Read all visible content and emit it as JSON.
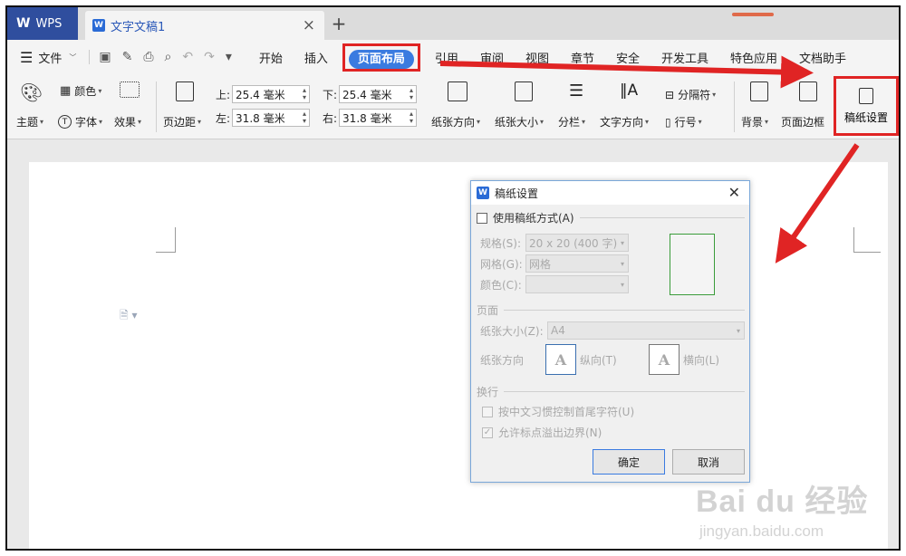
{
  "titlebar": {
    "app_tab": "WPS",
    "doc_tab": "文字文稿1",
    "close_glyph": "×",
    "new_tab_glyph": "+"
  },
  "menubar": {
    "file": "文件",
    "items": [
      "开始",
      "插入",
      "页面布局",
      "引用",
      "审阅",
      "视图",
      "章节",
      "安全",
      "开发工具",
      "特色应用",
      "文档助手"
    ],
    "active_index": 2
  },
  "ribbon": {
    "theme": "主题",
    "color": "颜色",
    "font": "字体",
    "effect": "效果",
    "margins": "页边距",
    "margin_top_label": "上:",
    "margin_top": "25.4 毫米",
    "margin_bottom_label": "下:",
    "margin_bottom": "25.4 毫米",
    "margin_left_label": "左:",
    "margin_left": "31.8 毫米",
    "margin_right_label": "右:",
    "margin_right": "31.8 毫米",
    "orientation": "纸张方向",
    "paper_size": "纸张大小",
    "columns": "分栏",
    "text_direction": "文字方向",
    "separator": "分隔符",
    "line_number": "行号",
    "background": "背景",
    "page_border": "页面边框",
    "grid_paper": "稿纸设置"
  },
  "dialog": {
    "title": "稿纸设置",
    "use_grid": "使用稿纸方式(A)",
    "spec_label": "规格(S):",
    "spec_value": "20 x 20 (400 字)",
    "grid_label": "网格(G):",
    "grid_value": "网格",
    "color_label": "颜色(C):",
    "page_group": "页面",
    "paper_size_label": "纸张大小(Z):",
    "paper_size_value": "A4",
    "orientation_label": "纸张方向",
    "portrait": "纵向(T)",
    "landscape": "横向(L)",
    "orient_glyph": "A",
    "wrap_group": "换行",
    "wrap_opt1": "按中文习惯控制首尾字符(U)",
    "wrap_opt2": "允许标点溢出边界(N)",
    "ok": "确定",
    "cancel": "取消"
  },
  "watermark": {
    "brand": "Bai du 经验",
    "url": "jingyan.baidu.com"
  },
  "colors": {
    "accent": "#3a7be0",
    "highlight": "#e02424",
    "wps_tab": "#2f4e9e"
  }
}
